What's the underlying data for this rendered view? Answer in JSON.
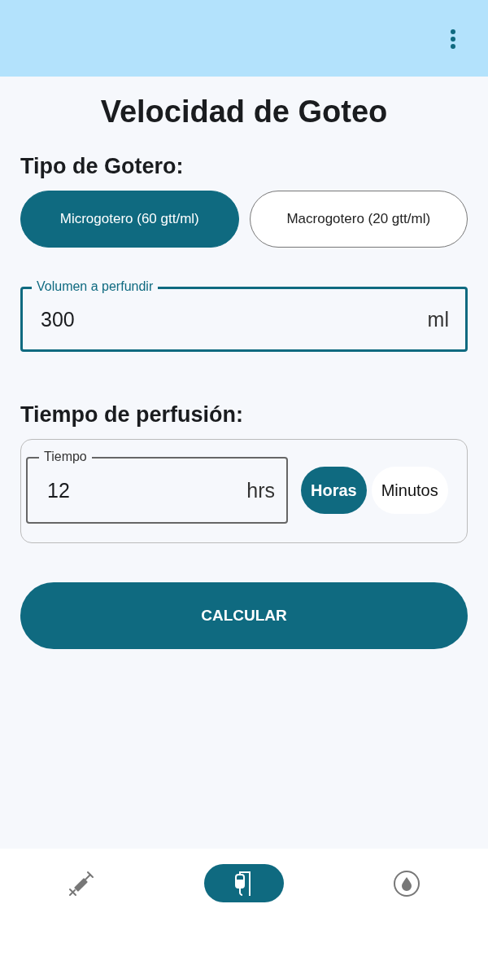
{
  "title": "Velocidad de Goteo",
  "drip_type": {
    "heading": "Tipo de Gotero:",
    "options": [
      {
        "label": "Microgotero (60 gtt/ml)",
        "selected": true
      },
      {
        "label": "Macrogotero (20 gtt/ml)",
        "selected": false
      }
    ]
  },
  "volume_field": {
    "label": "Volumen a perfundir",
    "value": "300",
    "suffix": "ml"
  },
  "time": {
    "heading": "Tiempo de perfusión:",
    "field": {
      "label": "Tiempo",
      "value": "12",
      "suffix": "hrs"
    },
    "units": [
      {
        "label": "Horas",
        "selected": true
      },
      {
        "label": "Minutos",
        "selected": false
      }
    ]
  },
  "calculate_button": "CALCULAR",
  "nav": [
    {
      "kind": "syringe",
      "selected": false
    },
    {
      "kind": "iv-bag",
      "selected": true
    },
    {
      "kind": "drop",
      "selected": false
    }
  ]
}
